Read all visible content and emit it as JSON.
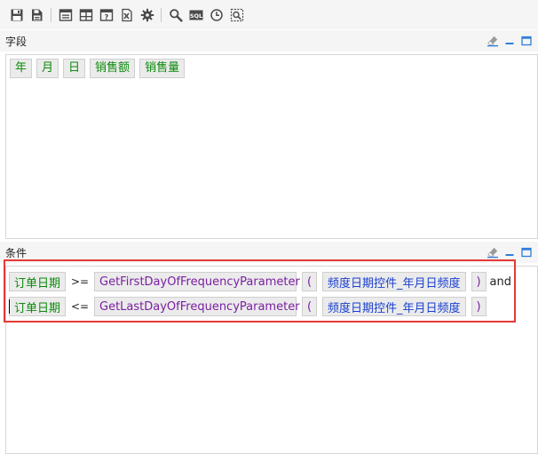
{
  "toolbar": {
    "buttons": [
      {
        "name": "save-icon"
      },
      {
        "name": "save-as-icon"
      },
      {
        "name": "window-icon"
      },
      {
        "name": "table-layout-icon"
      },
      {
        "name": "parameter-icon"
      },
      {
        "name": "excel-export-icon"
      },
      {
        "name": "gear-icon"
      },
      {
        "name": "search-icon"
      },
      {
        "name": "sql-icon",
        "label": "SQL"
      },
      {
        "name": "clock-icon"
      },
      {
        "name": "preview-icon"
      }
    ]
  },
  "fields_panel": {
    "title": "字段",
    "chips": [
      "年",
      "月",
      "日",
      "销售额",
      "销售量"
    ]
  },
  "conditions_panel": {
    "title": "条件",
    "rows": [
      {
        "field": "订单日期",
        "operator": ">=",
        "function": "GetFirstDayOfFrequencyParameter",
        "paren_open": "(",
        "param": "频度日期控件_年月日频度",
        "paren_close": ")",
        "connector": "and"
      },
      {
        "field": "订单日期",
        "operator": "<=",
        "function": "GetLastDayOfFrequencyParameter",
        "paren_open": "(",
        "param": "频度日期控件_年月日频度",
        "paren_close": ")",
        "connector": ""
      }
    ]
  },
  "colors": {
    "field": "#0a8a0a",
    "function": "#7b1fa2",
    "parameter": "#1a3fd0",
    "highlight": "#e53935",
    "accent": "#2f7ed8"
  }
}
